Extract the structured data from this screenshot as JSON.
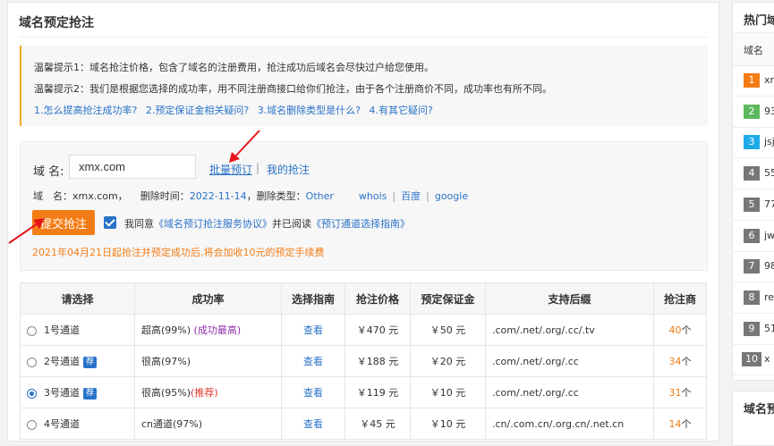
{
  "page": {
    "title": "域名预定抢注"
  },
  "tips": {
    "line1": "温馨提示1：域名抢注价格，包含了域名的注册费用，抢注成功后域名会尽快过户给您使用。",
    "line2": "温馨提示2：我们是根据您选择的成功率，用不同注册商接口给你们抢注，由于各个注册商价不同，成功率也有所不同。",
    "links": [
      "1.怎么提高抢注成功率?",
      "2.预定保证金相关疑问?",
      "3.域名删除类型是什么?",
      "4.有其它疑问?"
    ]
  },
  "form": {
    "domain_label": "域 名:",
    "domain_value": "xmx.com",
    "batch_link": "批量预订",
    "my_link": "我的抢注",
    "info_label": "域　名：",
    "info_domain": "xmx.com",
    "delete_time_label": "删除时间：",
    "delete_time": "2022-11-14",
    "delete_type_label": "删除类型：",
    "delete_type": "Other",
    "whois": "whois",
    "baidu": "百度",
    "google": "google",
    "submit_label": "提交抢注",
    "agree_text": "我同意",
    "agreement_link": "《域名预订抢注服务协议》",
    "agree_mid": "并已阅读",
    "guide_link": "《预订通道选择指南》",
    "notice": "2021年04月21日起抢注并预定成功后,将会加收10元的预定手续费"
  },
  "table": {
    "headers": [
      "请选择",
      "成功率",
      "选择指南",
      "抢注价格",
      "预定保证金",
      "支持后缀",
      "抢注商"
    ],
    "rows": [
      {
        "channel": "1号通道",
        "badge": "",
        "rate": "超高(99%)",
        "rate_note": "(成功最高)",
        "guide": "查看",
        "price": "￥470 元",
        "deposit": "￥50 元",
        "suffix": ".com/.net/.org/.cc/.tv",
        "count": "40",
        "unit": "个"
      },
      {
        "channel": "2号通道",
        "badge": "荐",
        "rate": "很高(97%)",
        "rate_note": "",
        "guide": "查看",
        "price": "￥188 元",
        "deposit": "￥20 元",
        "suffix": ".com/.net/.org/.cc",
        "count": "34",
        "unit": "个"
      },
      {
        "channel": "3号通道",
        "badge": "荐",
        "rate": "很高(95%)",
        "rate_note": "(推荐)",
        "guide": "查看",
        "price": "￥119 元",
        "deposit": "￥10 元",
        "suffix": ".com/.net/.org/.cc",
        "count": "31",
        "unit": "个"
      },
      {
        "channel": "4号通道",
        "badge": "",
        "rate": "cn通道(97%)",
        "rate_note": "",
        "guide": "查看",
        "price": "￥45 元",
        "deposit": "￥10 元",
        "suffix": ".cn/.com.cn/.org.cn/.net.cn",
        "count": "14",
        "unit": "个"
      }
    ],
    "selected_row": 2
  },
  "sidebar": {
    "title": "热门域",
    "col_header": "域名",
    "items": [
      {
        "rank": "1",
        "name": "xn",
        "color": "#f47c14"
      },
      {
        "rank": "2",
        "name": "93",
        "color": "#5cb85c"
      },
      {
        "rank": "3",
        "name": "jsj",
        "color": "#1eaae8"
      },
      {
        "rank": "4",
        "name": "55",
        "color": "#777777"
      },
      {
        "rank": "5",
        "name": "77",
        "color": "#777777"
      },
      {
        "rank": "6",
        "name": "jw",
        "color": "#777777"
      },
      {
        "rank": "7",
        "name": "98",
        "color": "#777777"
      },
      {
        "rank": "8",
        "name": "re",
        "color": "#777777"
      },
      {
        "rank": "9",
        "name": "51",
        "color": "#777777"
      },
      {
        "rank": "10",
        "name": "x",
        "color": "#777777"
      }
    ],
    "title2": "域名预"
  },
  "colors": {
    "accent": "#f47c14",
    "link": "#2a72c8",
    "tip_border": "#f5a623"
  }
}
